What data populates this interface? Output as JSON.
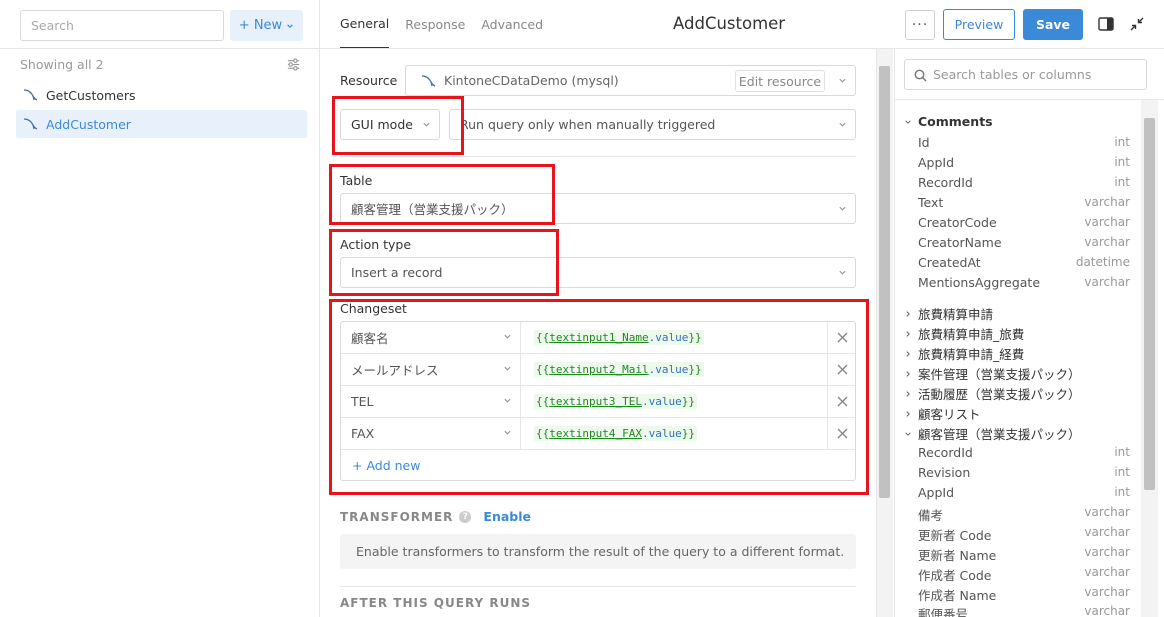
{
  "left": {
    "search_placeholder": "Search",
    "new_label": "+ New",
    "showing": "Showing all 2",
    "queries": [
      {
        "name": "GetCustomers"
      },
      {
        "name": "AddCustomer"
      }
    ]
  },
  "header": {
    "tabs": [
      "General",
      "Response",
      "Advanced"
    ],
    "title": "AddCustomer",
    "more": "···",
    "preview": "Preview",
    "save": "Save"
  },
  "form": {
    "resource_label": "Resource",
    "resource_value": "KintoneCDataDemo (mysql)",
    "edit_resource": "Edit resource",
    "mode_value": "GUI mode",
    "trigger_value": "Run query only when manually triggered",
    "table_label": "Table",
    "table_value": "顧客管理（営業支援パック）",
    "action_label": "Action type",
    "action_value": "Insert a record",
    "changeset_label": "Changeset",
    "changeset": [
      {
        "key": "顧客名",
        "open": "{{",
        "ref": "textinput1_Name",
        "prop": ".value",
        "close": "}}"
      },
      {
        "key": "メールアドレス",
        "open": "{{",
        "ref": "textinput2_Mail",
        "prop": ".value",
        "close": "}}"
      },
      {
        "key": "TEL",
        "open": "{{",
        "ref": "textinput3_TEL",
        "prop": ".value",
        "close": "}}"
      },
      {
        "key": "FAX",
        "open": "{{",
        "ref": "textinput4_FAX",
        "prop": ".value",
        "close": "}}"
      }
    ],
    "add_new": "+ Add new",
    "transformer_label": "TRANSFORMER",
    "transformer_enable": "Enable",
    "transformer_info": "Enable transformers to transform the result of the query to a different format.",
    "after_label": "AFTER THIS QUERY RUNS"
  },
  "schema": {
    "search_placeholder": "Search tables or columns",
    "comments_table": "Comments",
    "comments_cols": [
      {
        "name": "Id",
        "type": "int"
      },
      {
        "name": "AppId",
        "type": "int"
      },
      {
        "name": "RecordId",
        "type": "int"
      },
      {
        "name": "Text",
        "type": "varchar"
      },
      {
        "name": "CreatorCode",
        "type": "varchar"
      },
      {
        "name": "CreatorName",
        "type": "varchar"
      },
      {
        "name": "CreatedAt",
        "type": "datetime"
      },
      {
        "name": "MentionsAggregate",
        "type": "varchar"
      }
    ],
    "collapsed_tables": [
      "旅費精算申請",
      "旅費精算申請_旅費",
      "旅費精算申請_経費",
      "案件管理（営業支援パック）",
      "活動履歴（営業支援パック）",
      "顧客リスト"
    ],
    "open_table": "顧客管理（営業支援パック）",
    "open_cols": [
      {
        "name": "RecordId",
        "type": "int"
      },
      {
        "name": "Revision",
        "type": "int"
      },
      {
        "name": "AppId",
        "type": "int"
      },
      {
        "name": "備考",
        "type": "varchar"
      },
      {
        "name": "更新者 Code",
        "type": "varchar"
      },
      {
        "name": "更新者 Name",
        "type": "varchar"
      },
      {
        "name": "作成者 Code",
        "type": "varchar"
      },
      {
        "name": "作成者 Name",
        "type": "varchar"
      },
      {
        "name": "郵便番号",
        "type": "varchar"
      }
    ]
  }
}
